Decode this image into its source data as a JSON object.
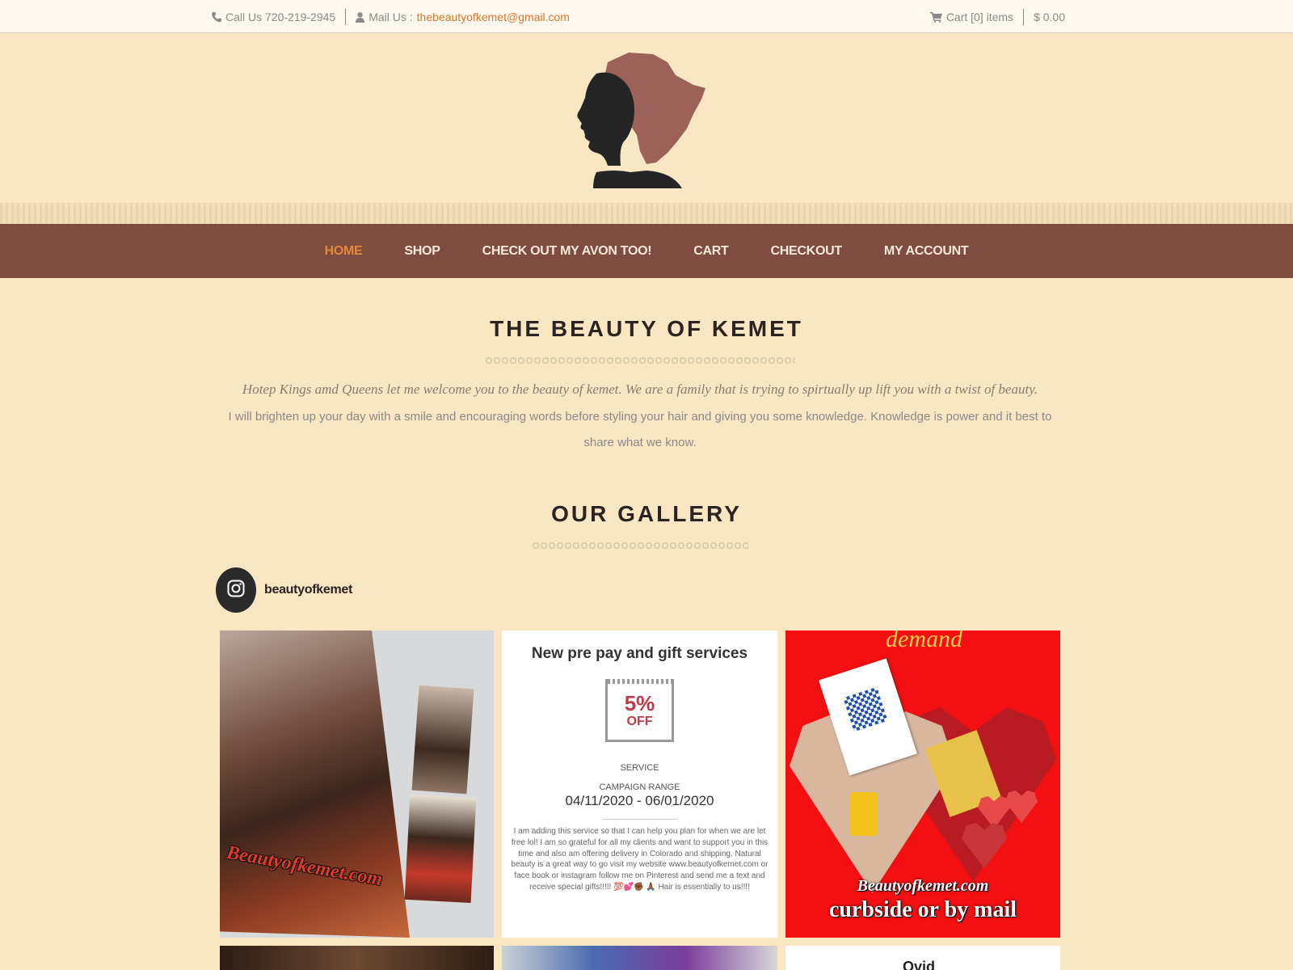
{
  "topbar": {
    "phone_label": "Call Us 720-219-2945",
    "mail_prefix": "Mail Us :",
    "mail_address": "thebeautyofkemet@gmail.com",
    "cart_label": "Cart [0] items",
    "cart_total": "$ 0.00"
  },
  "nav": {
    "items": [
      {
        "label": "HOME",
        "active": true
      },
      {
        "label": "SHOP"
      },
      {
        "label": "CHECK OUT MY AVON TOO!"
      },
      {
        "label": "CART"
      },
      {
        "label": "CHECKOUT"
      },
      {
        "label": "MY ACCOUNT"
      }
    ]
  },
  "welcome": {
    "title": "THE BEAUTY OF KEMET",
    "italic": "Hotep Kings amd Queens let me welcome you to the beauty of kemet. We are a family that is trying to spirtually up lift you with a twist of beauty.",
    "body": "I will brighten up your day with a smile and encouraging words before styling your hair and giving you some knowledge. Knowledge is power and it best to share what we know."
  },
  "gallery": {
    "title": "OUR GALLERY",
    "instagram_user": "beautyofkemet"
  },
  "tiles": {
    "t1_brand": "Beautyofkemet.com",
    "t2": {
      "title": "New pre pay and gift services",
      "percent": "5%",
      "off": "OFF",
      "service": "SERVICE",
      "campaign": "CAMPAIGN RANGE",
      "dates": "04/11/2020 - 06/01/2020",
      "text": "I am adding this service so that I can help you plan for when we are let free lol! I am so grateful for all my clients and want to support you in this time and also am offering delivery in Colorado and shipping. Natural beauty is a great way to go visit my website www.beautyofkemet.com or face book or instagram follow me on Pinterest and send me a text and receive special gifts!!!!! 💯💕✊🏾 🙏🏾 Hair is essentially to us!!!!"
    },
    "t3": {
      "demand": "demand",
      "site": "Beautyofkemet.com",
      "tagline": "curbside or by mail"
    },
    "t6_peek": "Ovid"
  },
  "colors": {
    "background": "#f9e6c3",
    "nav": "#7f4c3f",
    "accent": "#e48a3c"
  }
}
